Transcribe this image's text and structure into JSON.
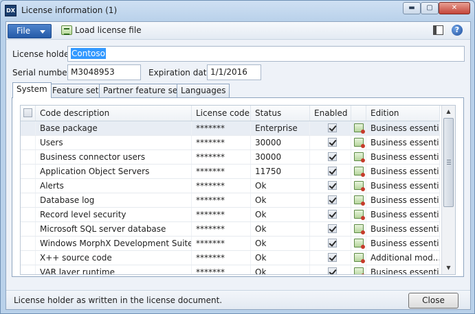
{
  "window": {
    "title": "License information (1)",
    "icon_text": "DX",
    "controls": [
      "minimize-icon",
      "maximize-icon",
      "close-icon"
    ],
    "minimize_glyph": "▬",
    "maximize_glyph": "▢",
    "close_glyph": "✕"
  },
  "actionbar": {
    "file_label": "File",
    "load_label": "Load license file",
    "help_glyph": "?"
  },
  "form": {
    "license_holder_label": "License holder:",
    "license_holder_value": "Contoso",
    "serial_label": "Serial number:",
    "serial_value": "M3048953",
    "expiration_label": "Expiration date:",
    "expiration_value": "1/1/2016"
  },
  "tabs": [
    {
      "label": "System",
      "active": true
    },
    {
      "label": "Feature sets",
      "active": false
    },
    {
      "label": "Partner feature sets",
      "active": false
    },
    {
      "label": "Languages",
      "active": false
    }
  ],
  "grid": {
    "columns": [
      "Code description",
      "License code",
      "Status",
      "Enabled",
      "Edition"
    ],
    "rows": [
      {
        "description": "Base package",
        "license_code": "*******",
        "status": "Enterprise",
        "enabled": true,
        "edition": "Business essential"
      },
      {
        "description": "Users",
        "license_code": "*******",
        "status": "30000",
        "enabled": true,
        "edition": "Business essential"
      },
      {
        "description": "Business connector users",
        "license_code": "*******",
        "status": "30000",
        "enabled": true,
        "edition": "Business essential"
      },
      {
        "description": "Application Object Servers",
        "license_code": "*******",
        "status": "11750",
        "enabled": true,
        "edition": "Business essential"
      },
      {
        "description": "Alerts",
        "license_code": "*******",
        "status": "Ok",
        "enabled": true,
        "edition": "Business essential"
      },
      {
        "description": "Database log",
        "license_code": "*******",
        "status": "Ok",
        "enabled": true,
        "edition": "Business essential"
      },
      {
        "description": "Record level security",
        "license_code": "*******",
        "status": "Ok",
        "enabled": true,
        "edition": "Business essential"
      },
      {
        "description": "Microsoft SQL server database",
        "license_code": "*******",
        "status": "Ok",
        "enabled": true,
        "edition": "Business essential"
      },
      {
        "description": "Windows MorphX Development Suite",
        "license_code": "*******",
        "status": "Ok",
        "enabled": true,
        "edition": "Business essential"
      },
      {
        "description": "X++ source code",
        "license_code": "*******",
        "status": "Ok",
        "enabled": true,
        "edition": "Additional mod..."
      },
      {
        "description": "VAR layer runtime",
        "license_code": "*******",
        "status": "Ok",
        "enabled": true,
        "edition": "Business essential"
      }
    ],
    "scroll_up_glyph": "▲",
    "scroll_down_glyph": "▼"
  },
  "statusbar": {
    "text": "License holder as written in the license document.",
    "close_label": "Close"
  }
}
